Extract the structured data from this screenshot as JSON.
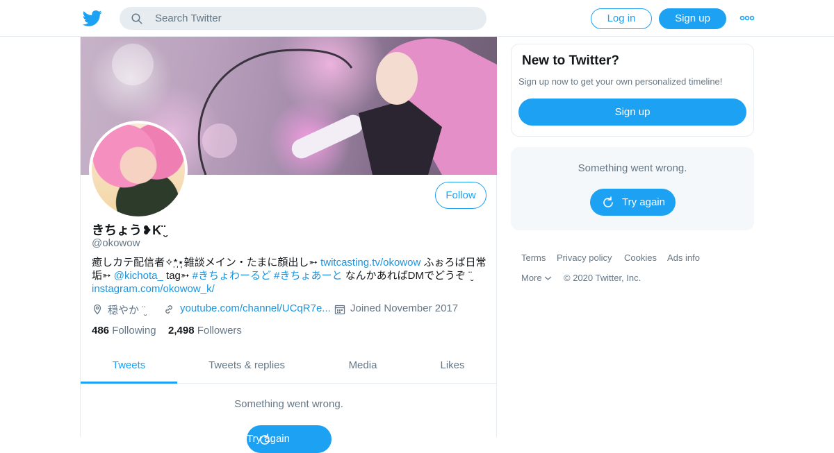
{
  "header": {
    "search_placeholder": "Search Twitter",
    "login_label": "Log in",
    "signup_label": "Sign up",
    "logo_icon": "twitter-bird-icon",
    "more_icon": "more-dots-icon"
  },
  "profile": {
    "follow_label": "Follow",
    "name": "きちょう❥K¨̮",
    "handle": "@okowow",
    "bio": {
      "t1": "癒しカテ配信者✧*̣̩⋆̩雑談メイン・たまに顔出し➳ ",
      "l1": "twitcasting.tv/okowow",
      "t2": " ふぉろば日常垢➳ ",
      "l2": "@kichota_",
      "t3": " tag➳ ",
      "l3": "#きちょわーるど",
      "t4": " ",
      "l4": "#きちょあーと",
      "t5": " なんかあればDMでどうぞ ¨̮ ",
      "l5": "instagram.com/okowow_k/"
    },
    "location": "穏やか ¨̮",
    "url": "youtube.com/channel/UCqR7e...",
    "joined": "Joined November 2017",
    "following_count": "486",
    "following_label": "Following",
    "followers_count": "2,498",
    "followers_label": "Followers",
    "tabs": [
      "Tweets",
      "Tweets & replies",
      "Media",
      "Likes"
    ],
    "active_tab": "Tweets",
    "error_text": "Something went wrong.",
    "retry_label": "Try again"
  },
  "sidebar": {
    "new_title": "New to Twitter?",
    "new_desc": "Sign up now to get your own personalized timeline!",
    "signup_label": "Sign up",
    "error_text": "Something went wrong.",
    "retry_label": "Try again"
  },
  "footer": {
    "terms": "Terms",
    "privacy": "Privacy policy",
    "cookies": "Cookies",
    "ads": "Ads info",
    "more": "More",
    "copyright": "© 2020 Twitter, Inc."
  },
  "colors": {
    "accent": "#1da1f2",
    "link": "#1b95e0",
    "muted": "#657786",
    "border": "#e6ecf0"
  }
}
